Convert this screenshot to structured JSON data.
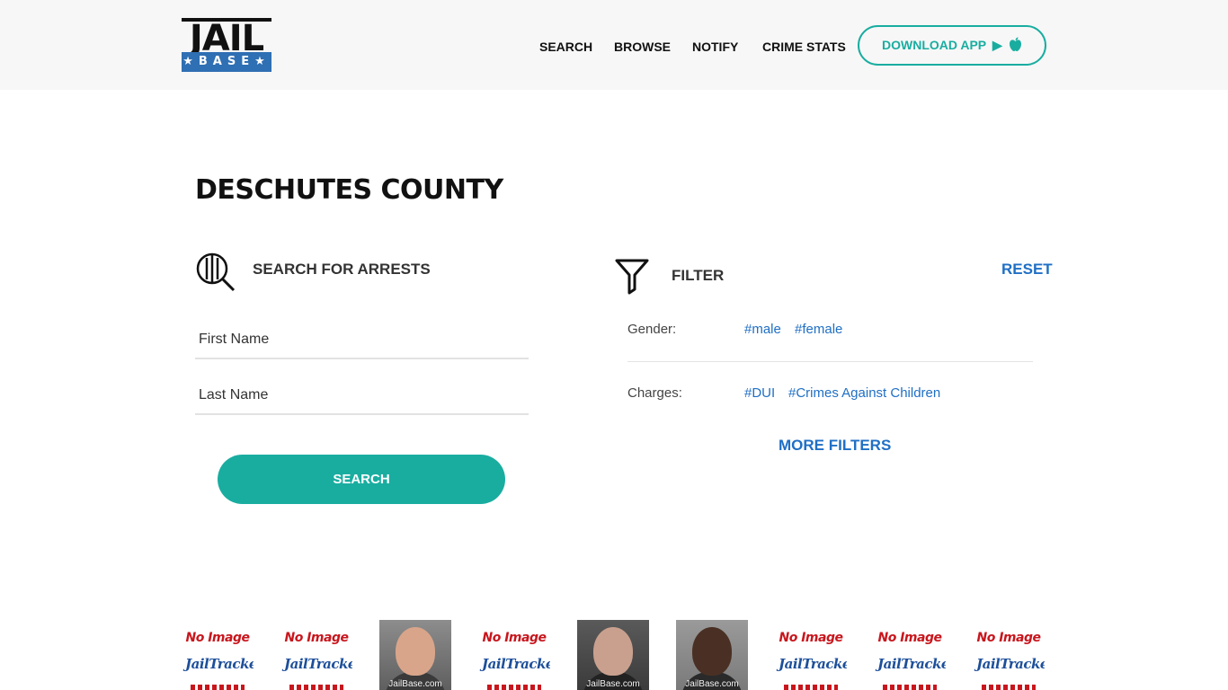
{
  "header": {
    "logo": {
      "top": "JAIL",
      "bottom": "BASE"
    },
    "nav": [
      "SEARCH",
      "BROWSE",
      "NOTIFY",
      "CRIME STATS"
    ],
    "download_label": "DOWNLOAD APP",
    "download_icons": [
      "play-store-icon",
      "apple-icon"
    ]
  },
  "page": {
    "title": "DESCHUTES COUNTY"
  },
  "search": {
    "title": "SEARCH FOR ARRESTS",
    "first_name_placeholder": "First Name",
    "last_name_placeholder": "Last Name",
    "button": "SEARCH"
  },
  "filter": {
    "title": "FILTER",
    "reset": "RESET",
    "gender_label": "Gender:",
    "gender_tags": [
      "#male",
      "#female"
    ],
    "charges_label": "Charges:",
    "charges_tags": [
      "#DUI",
      "#Crimes Against Children"
    ],
    "more": "MORE FILTERS"
  },
  "thumbnails": [
    {
      "type": "no-image",
      "top": "No Image",
      "mid": "JailTracker"
    },
    {
      "type": "no-image",
      "top": "No Image",
      "mid": "JailTracker"
    },
    {
      "type": "photo",
      "watermark": "JailBase.com"
    },
    {
      "type": "no-image",
      "top": "No Image",
      "mid": "JailTracker"
    },
    {
      "type": "photo",
      "watermark": "JailBase.com"
    },
    {
      "type": "photo",
      "watermark": "JailBase.com"
    },
    {
      "type": "no-image",
      "top": "No Image",
      "mid": "JailTracker"
    },
    {
      "type": "no-image",
      "top": "No Image",
      "mid": "JailTracker"
    },
    {
      "type": "no-image",
      "top": "No Image",
      "mid": "JailTracker"
    }
  ],
  "colors": {
    "accent": "#19ada0",
    "link": "#1f6fc5",
    "logo_blue": "#2f6fb3"
  }
}
